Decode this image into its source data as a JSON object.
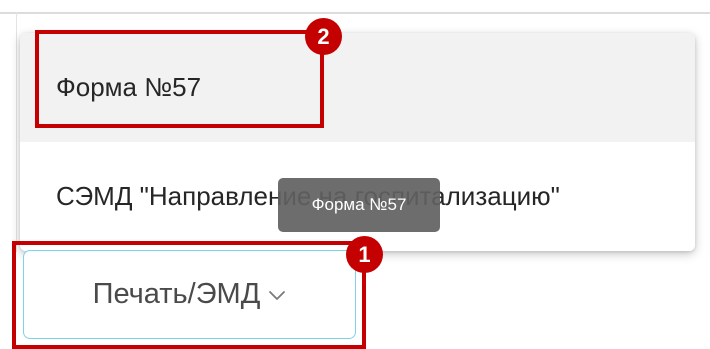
{
  "dropdown": {
    "items": [
      {
        "label": "Форма №57"
      },
      {
        "label": "СЭМД \"Направление на госпитализацию\""
      }
    ]
  },
  "tooltip": {
    "text": "Форма №57"
  },
  "print_button": {
    "label": "Печать/ЭМД",
    "icon": "chevron-down-icon"
  },
  "annotations": {
    "badges": [
      "1",
      "2"
    ],
    "color": "#c40000"
  },
  "colors": {
    "button_border": "#7fd3e8",
    "tooltip_bg": "#616161",
    "selected_item_bg": "#f2f2f2"
  }
}
